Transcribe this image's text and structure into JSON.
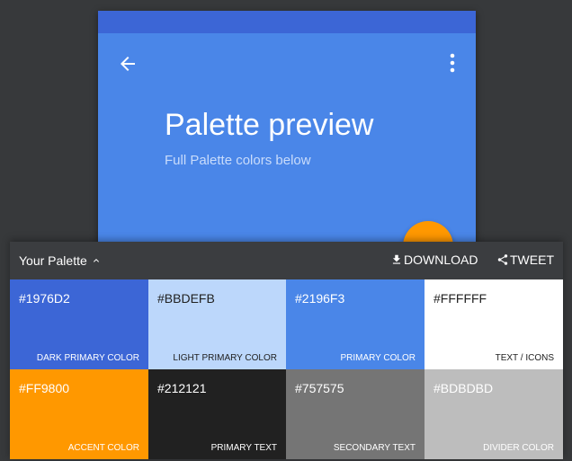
{
  "colors": {
    "background": "#37393b",
    "phone_bg": "#4a86e8",
    "status_bar": "#3c66d6",
    "fab": "#ff9800",
    "panel_header": "#3b3d40"
  },
  "preview": {
    "title": "Palette preview",
    "subtitle": "Full Palette colors below",
    "back_icon": "arrow-back-icon",
    "menu_icon": "more-vertical-icon"
  },
  "panel": {
    "toggle_label": "Your Palette",
    "toggle_icon": "chevron-up-icon",
    "download_label": "DOWNLOAD",
    "download_icon": "download-icon",
    "tweet_label": "TWEET",
    "tweet_icon": "share-icon"
  },
  "swatches": [
    {
      "hex": "#1976D2",
      "label": "Dark Primary Color",
      "bg": "#3c66d6",
      "text": "#ffffff",
      "label_color": "#ffffff"
    },
    {
      "hex": "#BBDEFB",
      "label": "Light Primary Color",
      "bg": "#bcd7fb",
      "text": "#212121",
      "label_color": "#212121"
    },
    {
      "hex": "#2196F3",
      "label": "Primary Color",
      "bg": "#4a86e8",
      "text": "#ffffff",
      "label_color": "#ffffff"
    },
    {
      "hex": "#FFFFFF",
      "label": "Text / Icons",
      "bg": "#ffffff",
      "text": "#212121",
      "label_color": "#212121"
    },
    {
      "hex": "#FF9800",
      "label": "Accent Color",
      "bg": "#ff9800",
      "text": "#ffffff",
      "label_color": "#ffffff"
    },
    {
      "hex": "#212121",
      "label": "Primary Text",
      "bg": "#212121",
      "text": "#ffffff",
      "label_color": "#ffffff"
    },
    {
      "hex": "#757575",
      "label": "Secondary Text",
      "bg": "#757575",
      "text": "#ffffff",
      "label_color": "#ffffff"
    },
    {
      "hex": "#BDBDBD",
      "label": "Divider Color",
      "bg": "#bdbdbd",
      "text": "#ffffff",
      "label_color": "#ffffff"
    }
  ]
}
